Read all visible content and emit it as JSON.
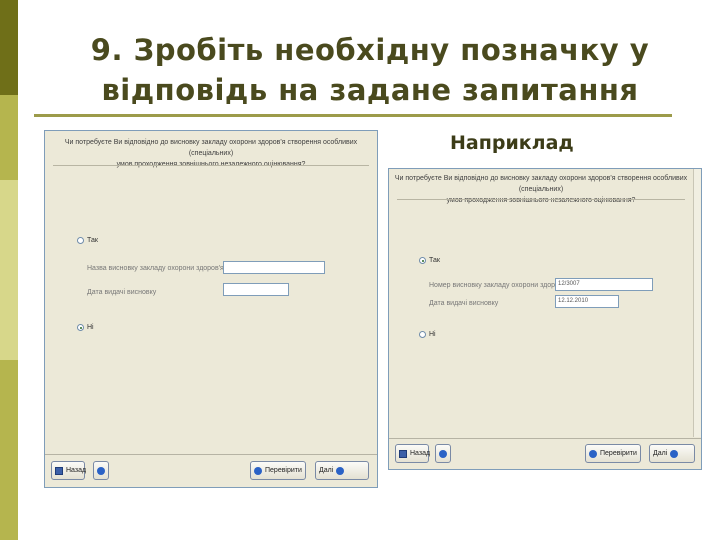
{
  "slide": {
    "title_line1": "9. Зробіть необхідну позначку у",
    "title_line2": "відповідь на задане запитання",
    "example_label": "Наприклад",
    "colors": {
      "sidebar_dark": "#6f6f18",
      "sidebar_mid": "#b5b54e",
      "sidebar_light": "#d7d78a",
      "title": "#4a4a1e",
      "rule": "#9c9b4a"
    }
  },
  "left_form": {
    "question_line1": "Чи потребуєте Ви відповідно до висновку закладу охорони здоров'я створення особливих (спеціальних)",
    "question_line2": "умов проходження зовнішнього незалежного оцінювання?",
    "option_yes": "Так",
    "field1_label": "Назва висновку закладу охорони здоров'я",
    "field1_value": "",
    "field2_label": "Дата видачі висновку",
    "field2_value": "",
    "option_no": "Ні",
    "selected": "no",
    "btn_back": "Назад",
    "btn_check": "Перевірити",
    "btn_next": "Далі"
  },
  "right_form": {
    "question_line1": "Чи потребуєте Ви відповідно до висновку закладу охорони здоров'я створення особливих (спеціальних)",
    "question_line2": "умов проходження зовнішнього незалежного оцінювання?",
    "option_yes": "Так",
    "field1_label": "Номер висновку закладу охорони здоров'я",
    "field1_value": "12/3007",
    "field2_label": "Дата видачі висновку",
    "field2_value": "12.12.2010",
    "option_no": "Ні",
    "selected": "yes",
    "btn_back": "Назад",
    "btn_check": "Перевірити",
    "btn_next": "Далі"
  }
}
